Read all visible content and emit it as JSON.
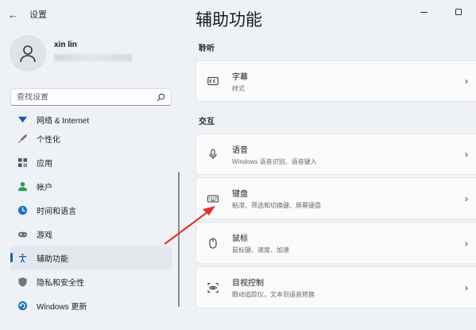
{
  "window": {
    "app_title": "设置",
    "back_icon": "back-arrow-icon",
    "minimize_icon": "minimize-icon",
    "maximize_icon": "maximize-icon"
  },
  "profile": {
    "name": "xin lin",
    "email": ""
  },
  "search": {
    "placeholder": "查找设置",
    "icon": "search-icon"
  },
  "sidebar": {
    "items": [
      {
        "label": "网络 & Internet",
        "icon": "network-icon",
        "icon_color": "#1a5fb4"
      },
      {
        "label": "个性化",
        "icon": "brush-icon",
        "icon_color": "#6d6d6d"
      },
      {
        "label": "应用",
        "icon": "apps-icon",
        "icon_color": "#4a5a6a"
      },
      {
        "label": "帐户",
        "icon": "account-icon",
        "icon_color": "#2e9e4e"
      },
      {
        "label": "时间和语言",
        "icon": "time-language-icon",
        "icon_color": "#1a73c8"
      },
      {
        "label": "游戏",
        "icon": "gaming-icon",
        "icon_color": "#6d6d6d"
      },
      {
        "label": "辅助功能",
        "icon": "accessibility-icon",
        "icon_color": "#1a5fb4",
        "active": true
      },
      {
        "label": "隐私和安全性",
        "icon": "shield-icon",
        "icon_color": "#6d7580"
      },
      {
        "label": "Windows 更新",
        "icon": "windows-update-icon",
        "icon_color": "#1a73c8"
      }
    ]
  },
  "main": {
    "title": "辅助功能",
    "sections": [
      {
        "label": "聆听",
        "cards": [
          {
            "title": "字幕",
            "subtitle": "样式",
            "icon": "captions-icon"
          }
        ]
      },
      {
        "label": "交互",
        "cards": [
          {
            "title": "语音",
            "subtitle": "Windows 语音识别、语音键入",
            "icon": "microphone-icon"
          },
          {
            "title": "键盘",
            "subtitle": "粘滞、筛选和切换键、屏幕键盘",
            "icon": "keyboard-icon"
          },
          {
            "title": "鼠标",
            "subtitle": "鼠标键、速度、加速",
            "icon": "mouse-icon"
          },
          {
            "title": "目视控制",
            "subtitle": "眼动追踪仪，文本到语音转换",
            "icon": "eye-control-icon"
          }
        ]
      }
    ]
  },
  "annotation": {
    "arrow_color": "#e5322d"
  }
}
